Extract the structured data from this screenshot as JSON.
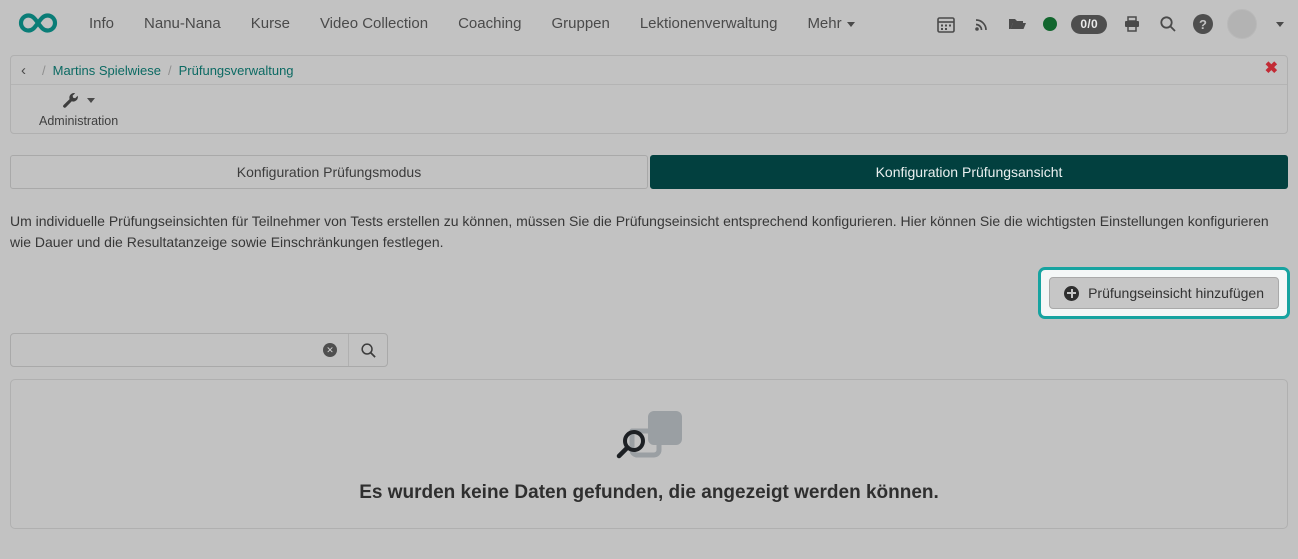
{
  "navbar": {
    "logo_icon": "infinity-logo",
    "logo_color": "#0a7d77",
    "items": [
      {
        "label": "Info",
        "has_caret": false
      },
      {
        "label": "Nanu-Nana",
        "has_caret": false
      },
      {
        "label": "Kurse",
        "has_caret": false
      },
      {
        "label": "Video Collection",
        "has_caret": false
      },
      {
        "label": "Coaching",
        "has_caret": false
      },
      {
        "label": "Gruppen",
        "has_caret": false
      },
      {
        "label": "Lektionenverwaltung",
        "has_caret": false
      },
      {
        "label": "Mehr",
        "has_caret": true
      }
    ],
    "tools": {
      "calendar_icon": "calendar-icon",
      "feed_icon": "rss-feed-icon",
      "folder_icon": "folder-icon",
      "status_dot": "online-status-dot",
      "status_color": "#12662e",
      "count_badge": "0/0",
      "print_icon": "print-icon",
      "search_icon": "search-icon",
      "help_icon": "help-icon",
      "help_glyph": "?",
      "avatar_icon": "user-avatar",
      "avatar_caret": "chevron-down-icon"
    }
  },
  "breadcrumb": {
    "back_icon": "chevron-left-icon",
    "back_glyph": "‹",
    "separator": "/",
    "items": [
      {
        "label": "Martins Spielwiese"
      },
      {
        "label": "Prüfungsverwaltung"
      }
    ],
    "close_glyph": "✖",
    "link_color": "#0c6a63"
  },
  "toolbar": {
    "administration": {
      "label": "Administration",
      "icon": "wrench-icon",
      "caret": "caret-down-icon"
    }
  },
  "tabs": [
    {
      "label": "Konfiguration Prüfungsmodus",
      "active": false
    },
    {
      "label": "Konfiguration Prüfungsansicht",
      "active": true
    }
  ],
  "active_tab_color": "#02403f",
  "description": "Um individuelle Prüfungseinsichten für Teilnehmer von Tests erstellen zu können, müssen Sie die Prüfungseinsicht entsprechend konfigurieren. Hier können Sie die wichtigsten Einstellungen konfigurieren wie Dauer und die Resultatanzeige sowie Einschränkungen festlegen.",
  "add_button": {
    "label": "Prüfungseinsicht hinzufügen",
    "icon": "plus-circle-icon",
    "highlighted": true,
    "highlight_color": "#16a3a0"
  },
  "search": {
    "value": "",
    "placeholder": "",
    "clear_icon": "clear-circle-icon",
    "clear_glyph": "✕",
    "search_icon": "search-icon"
  },
  "empty_state": {
    "icon": "no-data-search-icon",
    "message": "Es wurden keine Daten gefunden, die angezeigt werden können."
  }
}
